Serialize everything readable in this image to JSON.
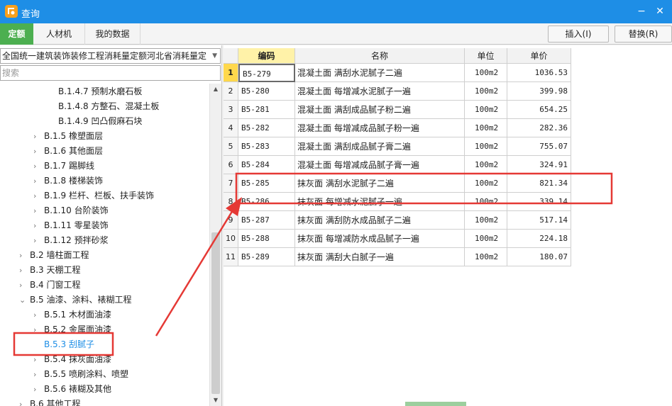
{
  "window": {
    "title": "查询",
    "minimize": "−",
    "close": "✕"
  },
  "tabs": [
    {
      "label": "定额",
      "active": true
    },
    {
      "label": "人材机",
      "active": false
    },
    {
      "label": "我的数据",
      "active": false
    }
  ],
  "buttons": {
    "insert": "插入(I)",
    "replace": "替换(R)"
  },
  "library_select": {
    "value": "全国统一建筑装饰装修工程消耗量定额河北省消耗量定"
  },
  "search": {
    "placeholder": "搜索"
  },
  "tree": [
    {
      "label": "B.1.4.7 预制水磨石板"
    },
    {
      "label": "B.1.4.8 方整石、混凝土板"
    },
    {
      "label": "B.1.4.9 凹凸假麻石块"
    },
    {
      "label": "B.1.5 橡塑面层"
    },
    {
      "label": "B.1.6 其他面层"
    },
    {
      "label": "B.1.7 踢脚线"
    },
    {
      "label": "B.1.8 楼梯装饰"
    },
    {
      "label": "B.1.9 栏杆、栏板、扶手装饰"
    },
    {
      "label": "B.1.10 台阶装饰"
    },
    {
      "label": "B.1.11 零星装饰"
    },
    {
      "label": "B.1.12 预拌砂浆"
    },
    {
      "label": "B.2 墙柱面工程"
    },
    {
      "label": "B.3 天棚工程"
    },
    {
      "label": "B.4 门窗工程"
    },
    {
      "label": "B.5 油漆、涂料、裱糊工程"
    },
    {
      "label": "B.5.1 木材面油漆"
    },
    {
      "label": "B.5.2 金属面油漆"
    },
    {
      "label": "B.5.3 刮腻子"
    },
    {
      "label": "B.5.4 抹灰面油漆"
    },
    {
      "label": "B.5.5 喷刷涂料、喷塑"
    },
    {
      "label": "B.5.6 裱糊及其他"
    },
    {
      "label": "B.6 其他工程"
    }
  ],
  "table": {
    "headers": {
      "code": "编码",
      "name": "名称",
      "unit": "单位",
      "price": "单价"
    },
    "rows": [
      {
        "num": "1",
        "code": "B5-279",
        "name": "混凝土面 满刮水泥腻子二遍",
        "unit": "100m2",
        "price": "1036.53"
      },
      {
        "num": "2",
        "code": "B5-280",
        "name": "混凝土面 每增减水泥腻子一遍",
        "unit": "100m2",
        "price": "399.98"
      },
      {
        "num": "3",
        "code": "B5-281",
        "name": "混凝土面 满刮成品腻子粉二遍",
        "unit": "100m2",
        "price": "654.25"
      },
      {
        "num": "4",
        "code": "B5-282",
        "name": "混凝土面 每增减成品腻子粉一遍",
        "unit": "100m2",
        "price": "282.36"
      },
      {
        "num": "5",
        "code": "B5-283",
        "name": "混凝土面 满刮成品腻子膏二遍",
        "unit": "100m2",
        "price": "755.07"
      },
      {
        "num": "6",
        "code": "B5-284",
        "name": "混凝土面 每增减成品腻子膏一遍",
        "unit": "100m2",
        "price": "324.91"
      },
      {
        "num": "7",
        "code": "B5-285",
        "name": "抹灰面 满刮水泥腻子二遍",
        "unit": "100m2",
        "price": "821.34"
      },
      {
        "num": "8",
        "code": "B5-286",
        "name": "抹灰面 每增减水泥腻子一遍",
        "unit": "100m2",
        "price": "339.14"
      },
      {
        "num": "9",
        "code": "B5-287",
        "name": "抹灰面 满刮防水成品腻子二遍",
        "unit": "100m2",
        "price": "517.14"
      },
      {
        "num": "10",
        "code": "B5-288",
        "name": "抹灰面 每增减防水成品腻子一遍",
        "unit": "100m2",
        "price": "224.18"
      },
      {
        "num": "11",
        "code": "B5-289",
        "name": "抹灰面 满刮大白腻子一遍",
        "unit": "100m2",
        "price": "180.07"
      }
    ]
  },
  "colors": {
    "titlebar": "#1e8ee6",
    "active_tab": "#4caf50",
    "annotation": "#e53935",
    "selected_text": "#1e8ee6",
    "header_code": "#fff2a8"
  }
}
